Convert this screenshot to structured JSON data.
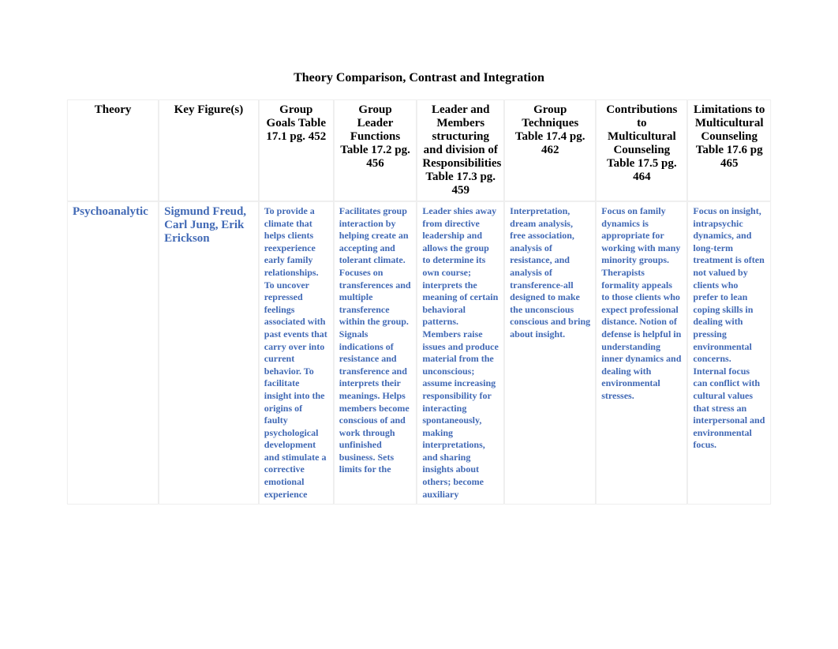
{
  "title": "Theory Comparison, Contrast and Integration",
  "headers": {
    "c0": "Theory",
    "c1": "Key Figure(s)",
    "c2": "Group Goals Table 17.1 pg. 452",
    "c3": "Group Leader Functions Table 17.2 pg. 456",
    "c4": "Leader and Members structuring and division of Responsibilities Table 17.3 pg. 459",
    "c5": "Group Techniques Table 17.4 pg. 462",
    "c6": "Contributions to Multicultural Counseling Table 17.5 pg. 464",
    "c7": "Limitations to Multicultural Counseling Table 17.6 pg 465"
  },
  "row": {
    "theory": "Psychoanalytic",
    "key_figures": "Sigmund Freud, Carl Jung, Erik Erickson",
    "goals": "To provide a climate that helps clients reexperience early family relationships. To uncover repressed feelings associated with past events that carry over into current behavior. To facilitate insight into the origins of faulty psychological development and stimulate a corrective emotional experience",
    "leader_functions": "Facilitates group interaction by helping create an accepting and tolerant climate. Focuses on transferences and multiple transference within the group. Signals indications of resistance and transference and interprets their meanings. Helps members become conscious of and work through unfinished business. Sets limits for the",
    "structuring": "Leader shies away from directive leadership and allows the group to determine its own course; interprets the meaning of certain behavioral patterns. Members raise issues and produce material from the unconscious; assume increasing responsibility for interacting spontaneously, making interpretations, and sharing insights about others; become auxiliary",
    "techniques": "Interpretation, dream analysis, free association, analysis of resistance, and analysis of transference-all designed to make the unconscious conscious and bring about insight.",
    "contributions": "Focus on family dynamics is appropriate for working with many minority groups. Therapists formality appeals to those clients who expect professional distance. Notion of defense is helpful in understanding inner dynamics and dealing with environmental stresses.",
    "limitations": "Focus on insight, intrapsychic dynamics, and long-term treatment is often not valued by clients who prefer to lean coping skills in dealing with pressing environmental concerns. Internal focus can conflict with cultural values that stress an interpersonal and environmental focus."
  }
}
